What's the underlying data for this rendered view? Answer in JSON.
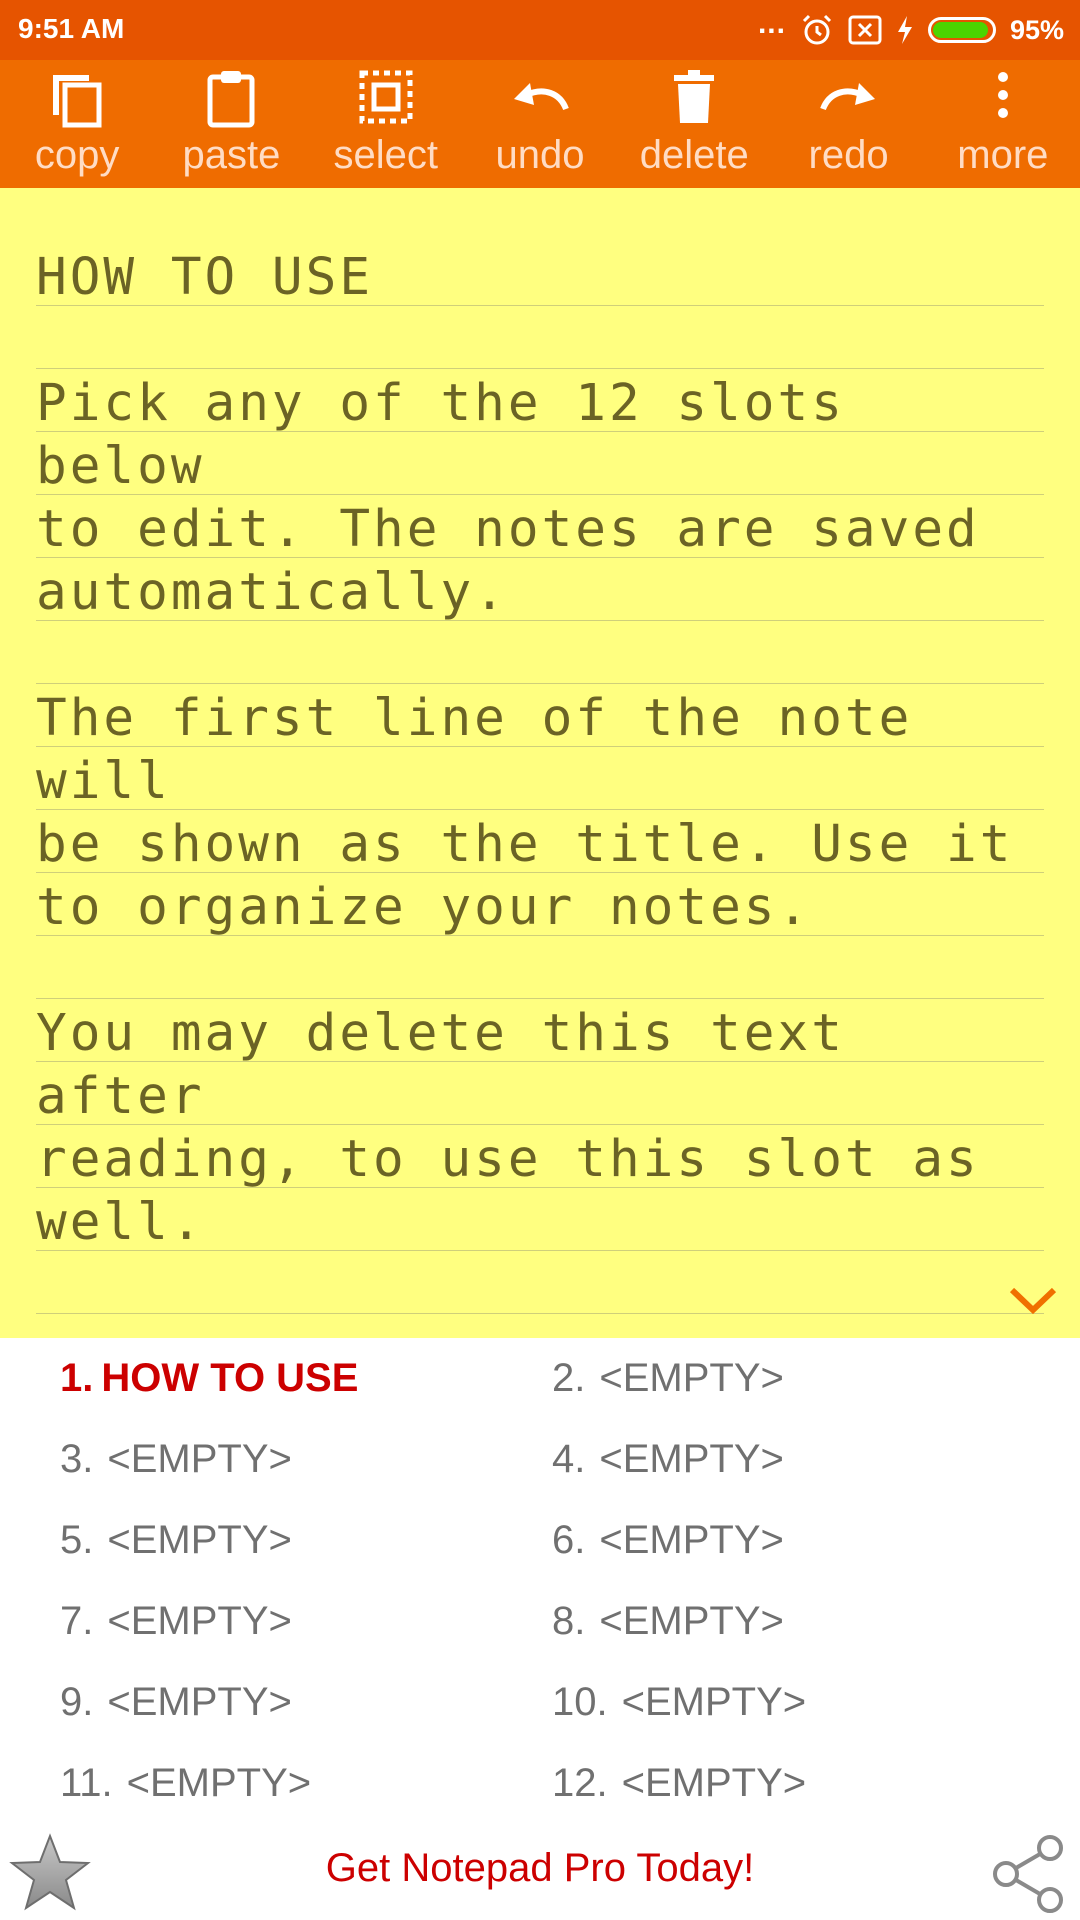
{
  "status": {
    "time": "9:51 AM",
    "dots": "...",
    "battery_percent": "95%",
    "battery_level": 0.95,
    "icons": [
      "alarm-icon",
      "sim-x-icon",
      "charging-icon",
      "battery-icon"
    ]
  },
  "toolbar": {
    "items": [
      {
        "label": "copy",
        "icon": "copy-icon"
      },
      {
        "label": "paste",
        "icon": "paste-icon"
      },
      {
        "label": "select",
        "icon": "select-icon"
      },
      {
        "label": "undo",
        "icon": "undo-icon"
      },
      {
        "label": "delete",
        "icon": "delete-icon"
      },
      {
        "label": "redo",
        "icon": "redo-icon"
      },
      {
        "label": "more",
        "icon": "more-vert-icon"
      }
    ]
  },
  "note": {
    "text": "HOW TO USE\n\nPick any of the 12 slots below\nto edit. The notes are saved\nautomatically.\n\nThe first line of the note will\nbe shown as the title. Use it\nto organize your notes.\n\nYou may delete this text after\nreading, to use this slot as\nwell."
  },
  "slots": [
    {
      "num": "1.",
      "title": "HOW TO USE",
      "active": true
    },
    {
      "num": "2.",
      "title": "<EMPTY>"
    },
    {
      "num": "3.",
      "title": "<EMPTY>"
    },
    {
      "num": "4.",
      "title": "<EMPTY>"
    },
    {
      "num": "5.",
      "title": "<EMPTY>"
    },
    {
      "num": "6.",
      "title": "<EMPTY>"
    },
    {
      "num": "7.",
      "title": "<EMPTY>"
    },
    {
      "num": "8.",
      "title": "<EMPTY>"
    },
    {
      "num": "9.",
      "title": "<EMPTY>"
    },
    {
      "num": "10.",
      "title": "<EMPTY>"
    },
    {
      "num": "11.",
      "title": "<EMPTY>"
    },
    {
      "num": "12.",
      "title": "<EMPTY>"
    }
  ],
  "bottom": {
    "promo": "Get Notepad Pro Today!"
  },
  "colors": {
    "status_bar": "#e65400",
    "toolbar": "#ef6c00",
    "note_bg": "#ffff80",
    "note_text": "#6b6325",
    "active_slot": "#cc0000",
    "slot_text": "#707070"
  }
}
